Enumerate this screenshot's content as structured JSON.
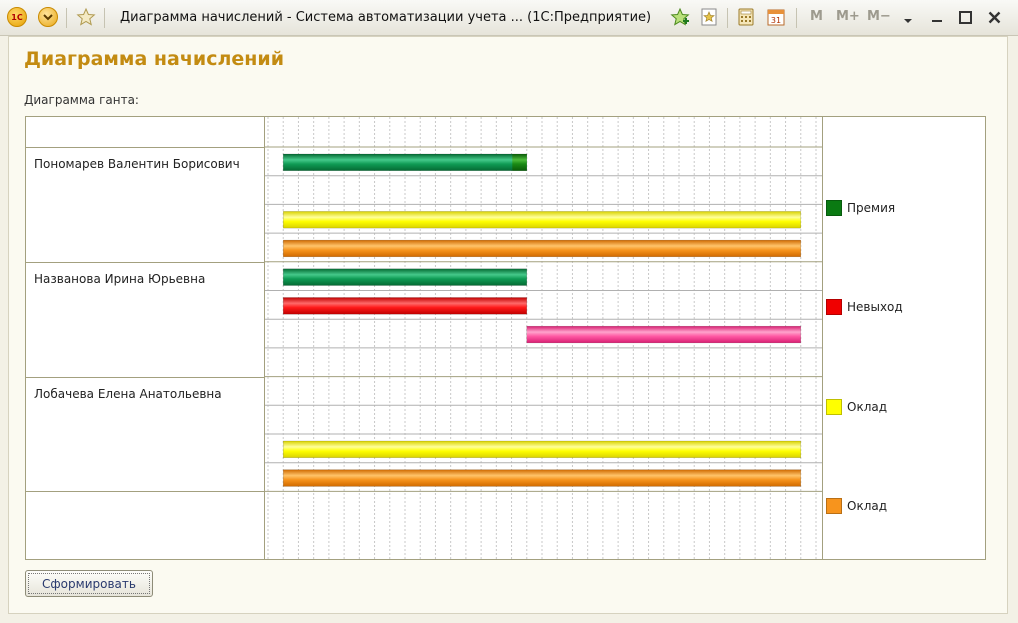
{
  "window": {
    "title": "Диаграмма начислений - Система автоматизации учета ...  (1С:Предприятие)",
    "logo_text": "1С",
    "m_buttons": [
      "M",
      "M+",
      "M−"
    ]
  },
  "form": {
    "title": "Диаграмма начислений",
    "gantt_caption": "Диаграмма ганта:",
    "button_label": "Сформировать"
  },
  "colors": {
    "premium": "#0a8a3a",
    "premium_end": "#0d7a12",
    "absence": "#f00000",
    "salary_yellow": "#ffff00",
    "salary_orange": "#f7941d",
    "pink": "#ff4f9e",
    "title": "#c38b12",
    "grid": "#b8b8b8",
    "border": "#a3a07f"
  },
  "gantt": {
    "timeline_columns": 36,
    "people": [
      {
        "name": "Пономарев Валентин Борисович"
      },
      {
        "name": "Названова Ирина Юрьевна"
      },
      {
        "name": "Лобачева Елена Анатольевна"
      },
      {
        "name": ""
      }
    ],
    "rows": [
      {
        "person": 0,
        "bar": {
          "kind": "premium",
          "start": 1,
          "end": 17,
          "end_cap": "premium_end"
        }
      },
      {
        "person": 0,
        "bar": null
      },
      {
        "person": 0,
        "bar": {
          "kind": "salary_yellow",
          "start": 1,
          "end": 35
        }
      },
      {
        "person": 0,
        "bar": {
          "kind": "salary_orange",
          "start": 1,
          "end": 35
        }
      },
      {
        "person": 1,
        "bar": {
          "kind": "premium",
          "start": 1,
          "end": 17
        }
      },
      {
        "person": 1,
        "bar": {
          "kind": "absence",
          "start": 1,
          "end": 17
        }
      },
      {
        "person": 1,
        "bar": {
          "kind": "pink",
          "start": 17,
          "end": 35
        }
      },
      {
        "person": 1,
        "bar": null
      },
      {
        "person": 2,
        "bar": null
      },
      {
        "person": 2,
        "bar": null
      },
      {
        "person": 2,
        "bar": {
          "kind": "salary_yellow",
          "start": 1,
          "end": 35
        }
      },
      {
        "person": 2,
        "bar": {
          "kind": "salary_orange",
          "start": 1,
          "end": 35
        }
      }
    ],
    "legend": [
      {
        "label": "Премия",
        "color": "#0a7a12"
      },
      {
        "label": "Невыход",
        "color": "#f00000"
      },
      {
        "label": "Оклад",
        "color": "#ffff00"
      },
      {
        "label": "Оклад",
        "color": "#f7941d"
      }
    ]
  }
}
